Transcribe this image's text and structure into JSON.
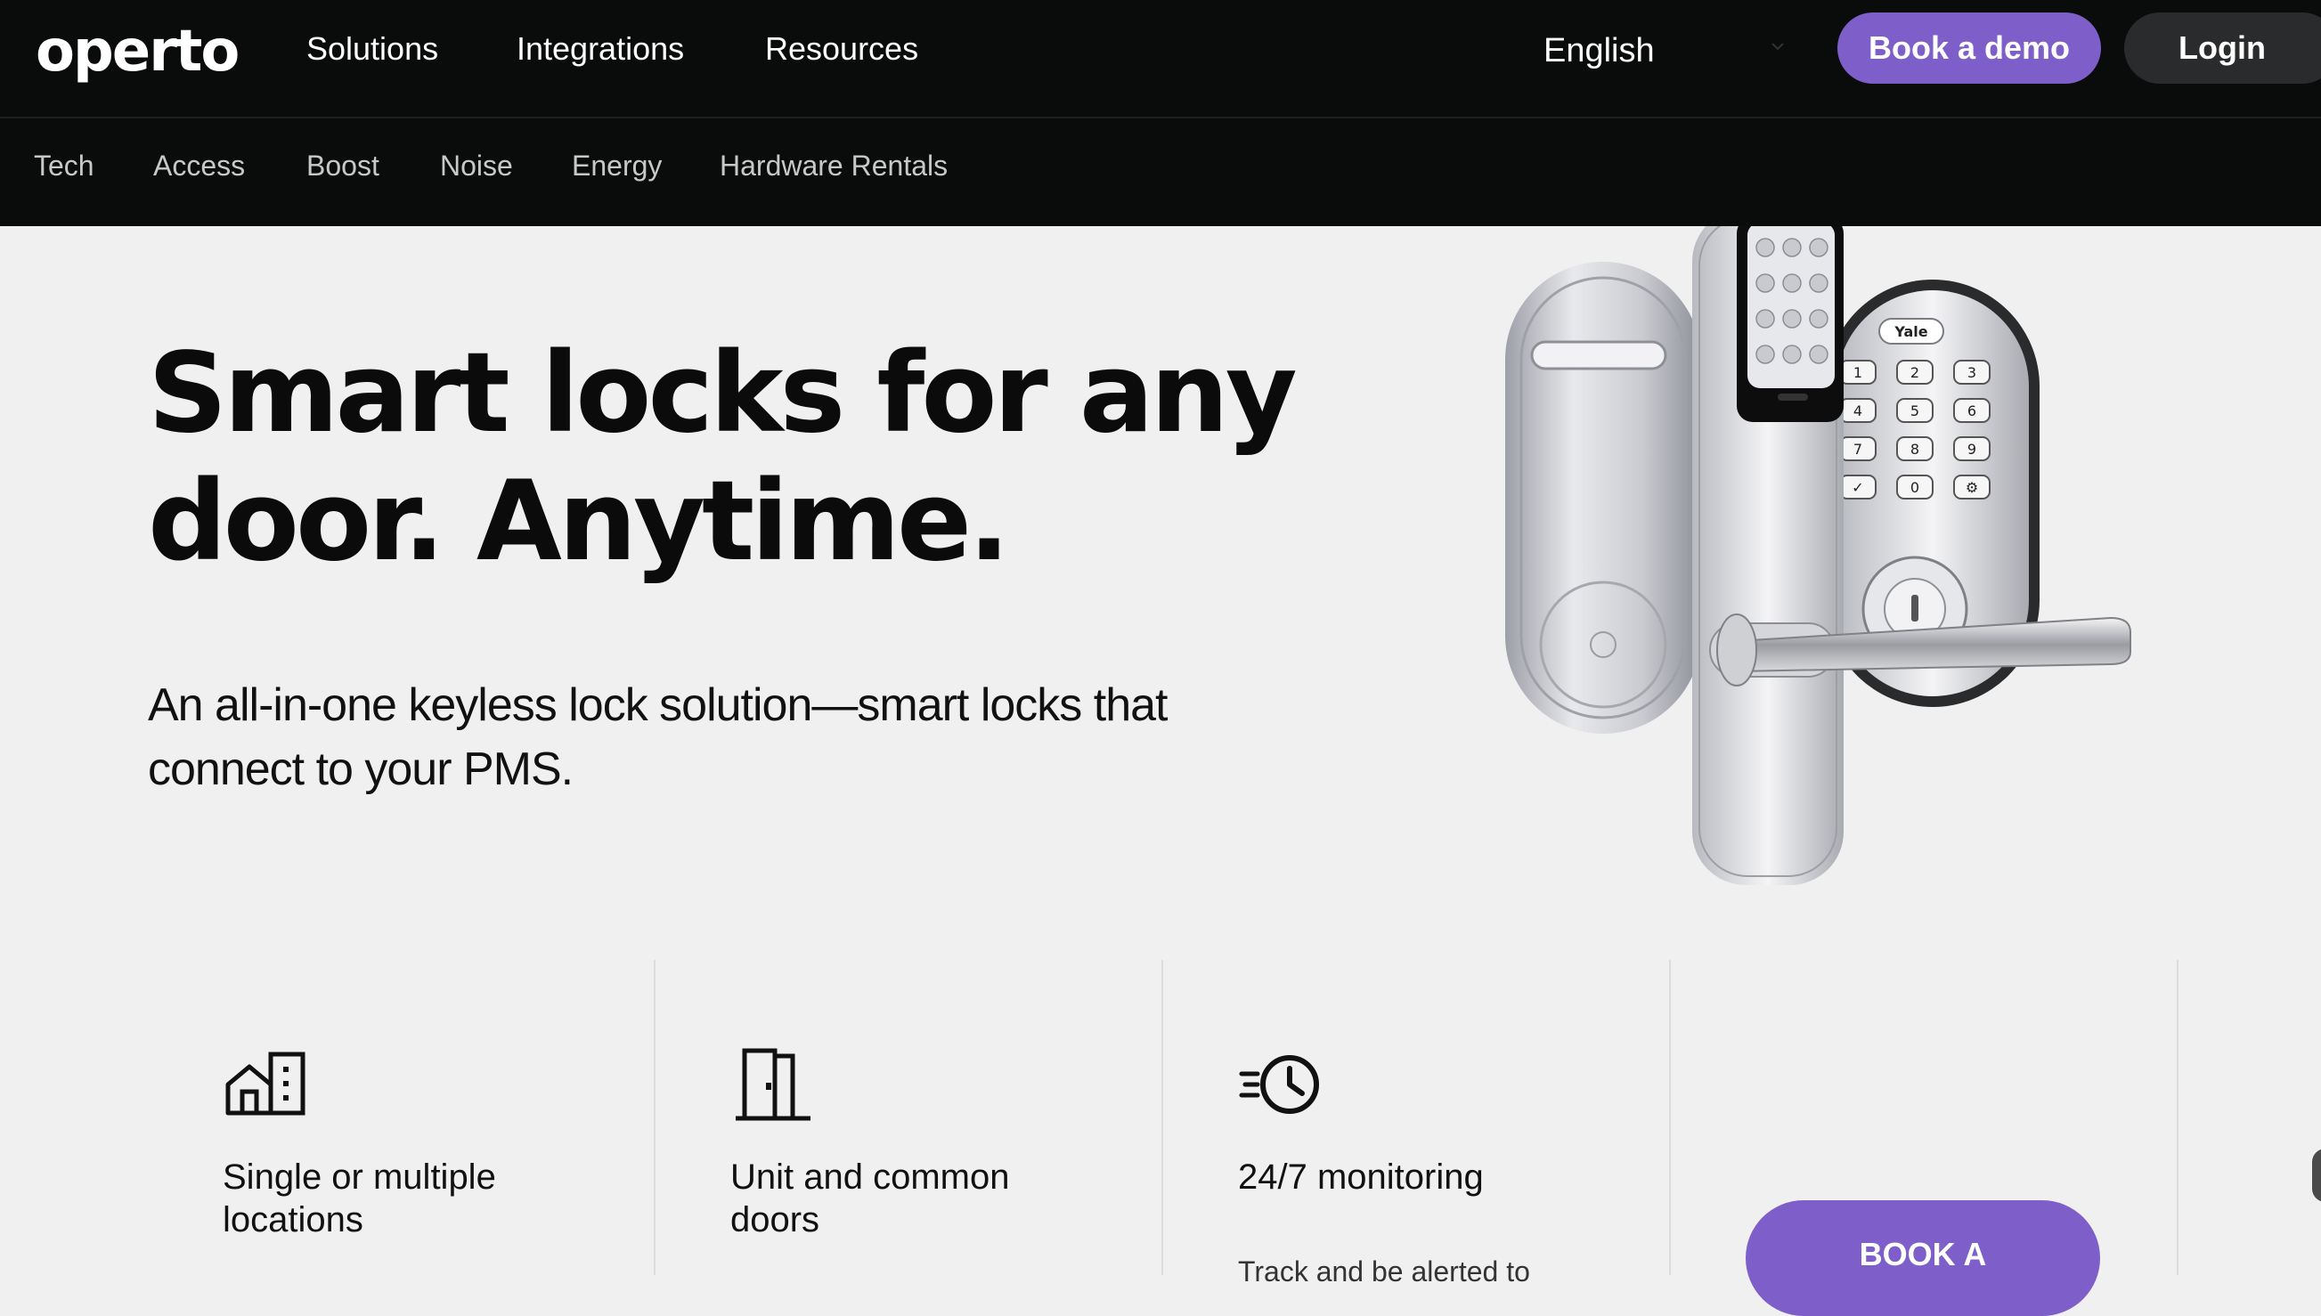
{
  "nav": {
    "logo": "operto",
    "links": [
      "Solutions",
      "Integrations",
      "Resources"
    ],
    "language": "English",
    "book_demo": "Book a demo",
    "login": "Login"
  },
  "subnav": {
    "links": [
      "Tech",
      "Access",
      "Boost",
      "Noise",
      "Energy",
      "Hardware Rentals"
    ]
  },
  "hero": {
    "title": "Smart locks for any door. Anytime.",
    "subtitle": "An all-in-one keyless lock solution—smart locks that connect to your PMS.",
    "image_brand": "Yale",
    "keypad": [
      "1",
      "2",
      "3",
      "4",
      "5",
      "6",
      "7",
      "8",
      "9",
      "✓",
      "0",
      "⚙"
    ]
  },
  "features": [
    {
      "icon": "building-icon",
      "title": "Single or multiple locations",
      "desc": ""
    },
    {
      "icon": "door-icon",
      "title": "Unit and common doors",
      "desc": ""
    },
    {
      "icon": "clock-speed-icon",
      "title": "24/7 monitoring",
      "desc": "Track and be alerted to"
    }
  ],
  "cta": {
    "label": "BOOK A"
  },
  "colors": {
    "nav_bg": "#0a0b0b",
    "page_bg": "#f0f0f0",
    "accent": "#7e5ec8",
    "login_bg": "#2a2b2c"
  }
}
